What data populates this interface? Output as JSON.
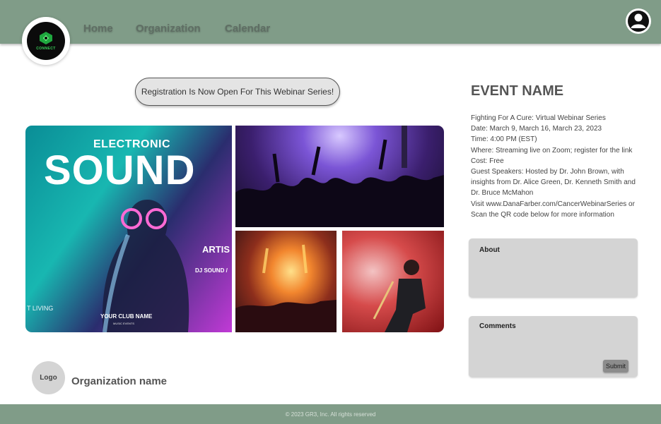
{
  "header": {
    "logo_text": "CONNECT",
    "nav": [
      {
        "label": "Home"
      },
      {
        "label": "Organization"
      },
      {
        "label": "Calendar"
      }
    ],
    "profile_icon": "user-circle-icon"
  },
  "registration": {
    "label": "Registration Is Now Open For This Webinar Series!"
  },
  "poster": {
    "headline_small": "ELECTRONIC",
    "headline_large": "SOUND",
    "artist": "ARTIS",
    "dj": "DJ SOUND /",
    "club": "YOUR CLUB NAME",
    "music": "MUSIC EVENTS",
    "side": "T LIVING"
  },
  "event": {
    "title": "EVENT NAME",
    "lines": [
      "Fighting For A Cure: Virtual Webinar Series",
      "Date: March 9, March 16, March 23, 2023",
      "Time: 4:00 PM (EST)",
      "Where: Streaming live on Zoom; register for the link",
      "Cost: Free",
      "Guest Speakers: Hosted by Dr. John Brown, with insights from Dr. Alice Green, Dr. Kenneth Smith and Dr. Bruce McMahon",
      "Visit www.DanaFarber.com/CancerWebinarSeries or Scan the QR code below for more information"
    ]
  },
  "about": {
    "label": "About"
  },
  "comments": {
    "label": "Comments",
    "submit_label": "Submit"
  },
  "organization": {
    "logo_label": "Logo",
    "name": "Organization name"
  },
  "footer": {
    "text": "© 2023 GR3, Inc. All rights reserved"
  },
  "colors": {
    "header_bg": "#809c88",
    "panel_bg": "#d4d4d4",
    "logo_accent": "#3ad35a"
  }
}
